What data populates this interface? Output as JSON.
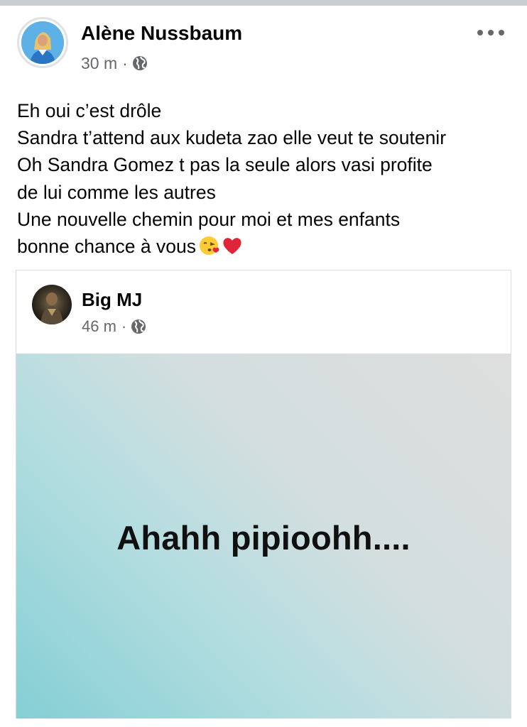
{
  "post": {
    "author": "Alène Nussbaum",
    "time": "30 m",
    "separator": "·",
    "privacy_icon": "globe-icon",
    "more_icon": "more-horizontal-icon",
    "text_lines": [
      "Eh oui c’est drôle",
      "Sandra t’attend aux kudeta zao elle veut te soutenir",
      "Oh Sandra Gomez t pas la seule alors vasi profite",
      "de lui  comme les autres",
      "Une nouvelle chemin pour moi et mes enfants",
      "bonne chance à vous"
    ],
    "text_emojis": [
      "face-blowing-kiss",
      "red-heart"
    ]
  },
  "shared_post": {
    "author": "Big MJ",
    "time": "46 m",
    "separator": "·",
    "privacy_icon": "globe-icon",
    "background_text": "Ahahh pipioohh....",
    "background_colors": [
      "#84cfd4",
      "#dedede"
    ]
  },
  "colors": {
    "text": "#050505",
    "meta": "#65676b",
    "divider": "#c9ccd1"
  }
}
